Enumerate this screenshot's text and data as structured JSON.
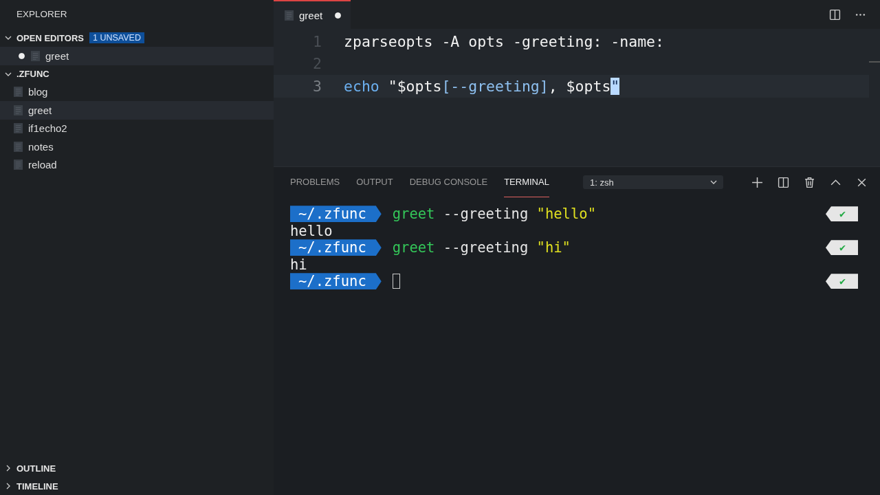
{
  "sidebar": {
    "title": "EXPLORER",
    "sections": [
      {
        "kind": "open_editors",
        "title": "OPEN EDITORS",
        "badge": "1 UNSAVED",
        "expanded": true,
        "items": [
          {
            "name": "greet",
            "dirty": true,
            "selected": true
          }
        ]
      },
      {
        "kind": "folder",
        "title": ".ZFUNC",
        "expanded": true,
        "items": [
          {
            "name": "blog",
            "selected": false
          },
          {
            "name": "greet",
            "selected": true
          },
          {
            "name": "if1echo2",
            "selected": false
          },
          {
            "name": "notes",
            "selected": false
          },
          {
            "name": "reload",
            "selected": false
          }
        ]
      }
    ],
    "bottom_sections": [
      {
        "title": "OUTLINE",
        "expanded": false
      },
      {
        "title": "TIMELINE",
        "expanded": false
      }
    ]
  },
  "editor": {
    "tabs": [
      {
        "name": "greet",
        "dirty": true,
        "selected": true
      }
    ],
    "lines": [
      {
        "number": "1",
        "current": false,
        "tokens": [
          {
            "text": "zparseopts -A opts -greeting: -name:",
            "kind": "plain"
          }
        ]
      },
      {
        "number": "2",
        "current": false
      },
      {
        "number": "3",
        "current": true,
        "tokens": [
          {
            "text": "echo",
            "kind": "keyword"
          },
          {
            "text": " \"$opts",
            "kind": "plain"
          },
          {
            "text": "[--greeting]",
            "kind": "variable"
          },
          {
            "text": ", $opts",
            "kind": "plain"
          },
          {
            "text": "\"",
            "kind": "cursor"
          }
        ]
      }
    ]
  },
  "panel": {
    "tabs": [
      {
        "label": "PROBLEMS",
        "selected": false
      },
      {
        "label": "OUTPUT",
        "selected": false
      },
      {
        "label": "DEBUG CONSOLE",
        "selected": false
      },
      {
        "label": "TERMINAL",
        "selected": true
      }
    ],
    "terminal_select": "1: zsh",
    "terminal": [
      {
        "kind": "prompt",
        "path": "~/.zfunc",
        "command": "greet",
        "args": " --greeting ",
        "string": "\"hello\"",
        "status": "✔"
      },
      {
        "kind": "output",
        "text": "hello"
      },
      {
        "kind": "prompt",
        "path": "~/.zfunc",
        "command": "greet",
        "args": " --greeting ",
        "string": "\"hi\"",
        "status": "✔"
      },
      {
        "kind": "output",
        "text": "hi"
      },
      {
        "kind": "input",
        "path": "~/.zfunc",
        "status": "✔"
      }
    ]
  }
}
